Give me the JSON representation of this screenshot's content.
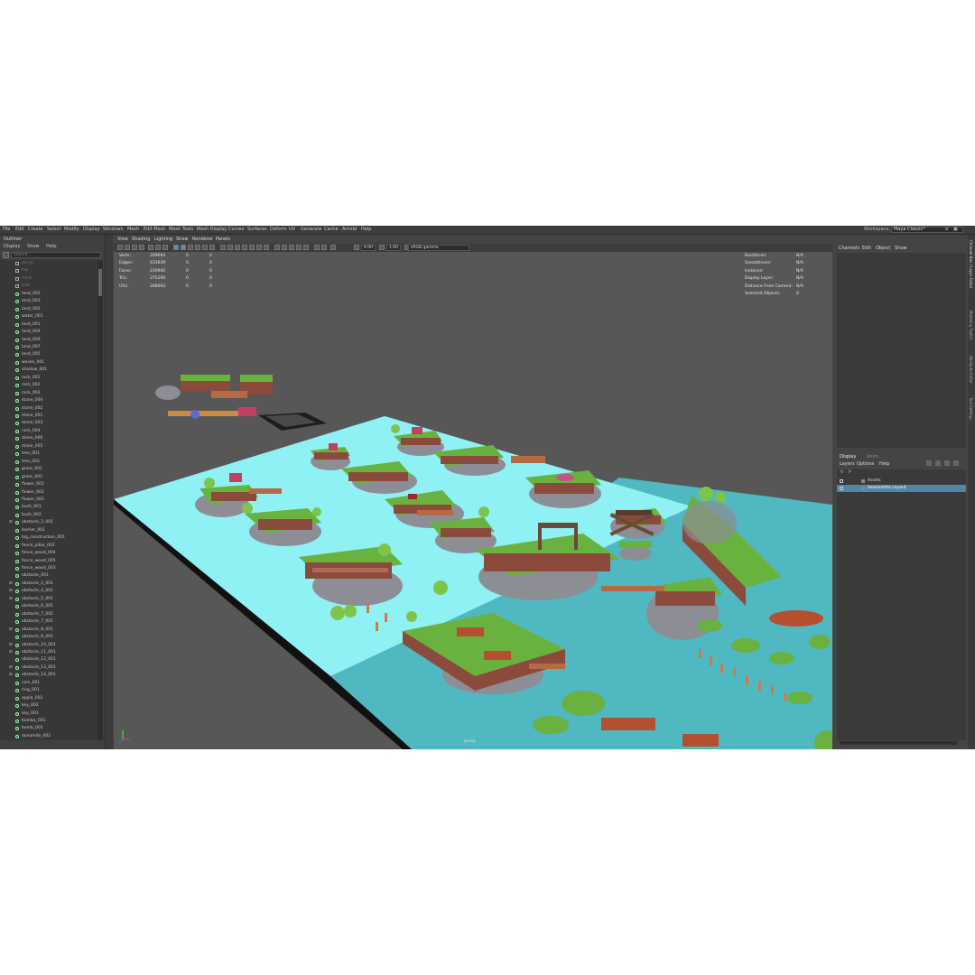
{
  "menubar": {
    "items": [
      "File",
      "Edit",
      "Create",
      "Select",
      "Modify",
      "Display",
      "Windows",
      "Mesh",
      "Edit Mesh",
      "Mesh Tools",
      "Mesh Display",
      "Curves",
      "Surfaces",
      "Deform",
      "UV",
      "Generate",
      "Cache",
      "Arnold",
      "Help"
    ],
    "workspace_label": "Workspace:",
    "workspace_value": "Maya Classic*"
  },
  "outliner": {
    "title": "Outliner",
    "menus": [
      "Display",
      "Show",
      "Help"
    ],
    "search_placeholder": "Search...",
    "items": [
      {
        "label": "persp",
        "dim": true
      },
      {
        "label": "top",
        "dim": true
      },
      {
        "label": "front",
        "dim": true
      },
      {
        "label": "side",
        "dim": true
      },
      {
        "label": "land_002"
      },
      {
        "label": "land_003"
      },
      {
        "label": "land_002"
      },
      {
        "label": "water_001"
      },
      {
        "label": "land_001"
      },
      {
        "label": "land_004"
      },
      {
        "label": "land_006"
      },
      {
        "label": "land_007"
      },
      {
        "label": "land_005"
      },
      {
        "label": "waves_001"
      },
      {
        "label": "shadow_001"
      },
      {
        "label": "rock_001"
      },
      {
        "label": "rock_002"
      },
      {
        "label": "rock_003"
      },
      {
        "label": "stone_004"
      },
      {
        "label": "stone_002"
      },
      {
        "label": "stone_001"
      },
      {
        "label": "stone_003"
      },
      {
        "label": "rock_004"
      },
      {
        "label": "stone_006"
      },
      {
        "label": "stone_005"
      },
      {
        "label": "tree_001"
      },
      {
        "label": "tree_002"
      },
      {
        "label": "grass_001"
      },
      {
        "label": "grass_002"
      },
      {
        "label": "flower_001"
      },
      {
        "label": "flower_002"
      },
      {
        "label": "flower_003"
      },
      {
        "label": "bush_001"
      },
      {
        "label": "bush_002"
      },
      {
        "label": "obstacle_3_001",
        "expand": true
      },
      {
        "label": "barrier_001"
      },
      {
        "label": "log_construction_001"
      },
      {
        "label": "fence_pillar_002"
      },
      {
        "label": "fence_wood_004"
      },
      {
        "label": "fence_wood_005"
      },
      {
        "label": "fence_wood_003"
      },
      {
        "label": "obstacle_001"
      },
      {
        "label": "obstacle_2_001",
        "expand": true
      },
      {
        "label": "obstacle_4_001",
        "expand": true
      },
      {
        "label": "obstacle_5_001",
        "expand": true
      },
      {
        "label": "obstacle_6_001"
      },
      {
        "label": "obstacle_7_002"
      },
      {
        "label": "obstacle_7_001"
      },
      {
        "label": "obstacle_8_001",
        "expand": true
      },
      {
        "label": "obstacle_9_001"
      },
      {
        "label": "obstacle_10_001",
        "expand": true
      },
      {
        "label": "obstacle_11_001",
        "expand": true
      },
      {
        "label": "obstacle_12_001"
      },
      {
        "label": "obstacle_13_001",
        "expand": true
      },
      {
        "label": "obstacle_14_001",
        "expand": true
      },
      {
        "label": "coin_001"
      },
      {
        "label": "ring_001"
      },
      {
        "label": "apple_001"
      },
      {
        "label": "key_002"
      },
      {
        "label": "key_001"
      },
      {
        "label": "bomba_001"
      },
      {
        "label": "bomb_001"
      },
      {
        "label": "dynamite_002"
      }
    ]
  },
  "viewport": {
    "menus": [
      "View",
      "Shading",
      "Lighting",
      "Show",
      "Renderer",
      "Panels"
    ],
    "field_a": "0.00",
    "field_b": "1.00",
    "colorspace": "sRGB gamma",
    "stats": [
      {
        "label": "Verts:",
        "value": "209693",
        "c1": "0",
        "c2": "0"
      },
      {
        "label": "Edges:",
        "value": "433639",
        "c1": "0",
        "c2": "0"
      },
      {
        "label": "Faces:",
        "value": "230942",
        "c1": "0",
        "c2": "0"
      },
      {
        "label": "Tris:",
        "value": "375290",
        "c1": "0",
        "c2": "0"
      },
      {
        "label": "UVs:",
        "value": "268093",
        "c1": "0",
        "c2": "0"
      }
    ],
    "info": [
      {
        "label": "Backfaces:",
        "value": "N/A"
      },
      {
        "label": "Smoothness:",
        "value": "N/A"
      },
      {
        "label": "Instance:",
        "value": "N/A"
      },
      {
        "label": "Display Layer:",
        "value": "N/A"
      },
      {
        "label": "Distance From Camera:",
        "value": "N/A"
      },
      {
        "label": "Selected Objects:",
        "value": "0"
      }
    ],
    "camera_label": "persp"
  },
  "channel_box": {
    "menus": [
      "Channels",
      "Edit",
      "Object",
      "Show"
    ]
  },
  "layer_editor": {
    "tabs": [
      "Display",
      "Anim"
    ],
    "menus": [
      "Layers",
      "Options",
      "Help"
    ],
    "header_v": "V",
    "header_p": "P",
    "layers": [
      {
        "name": "Assets",
        "selected": false
      },
      {
        "name": "Sessiontitle Layout",
        "selected": true
      }
    ]
  },
  "side_tabs": [
    "Channel Box / Layer Editor",
    "Modeling Toolkit",
    "Attribute Editor",
    "Tool Settings"
  ],
  "colors": {
    "ui_bg": "#444444",
    "viewport_bg": "#575757",
    "water": "#8ff1f3",
    "sea": "#4fb8c0",
    "grass": "#6ab23f",
    "dirt": "#8a4b3d",
    "rock": "#8d8d96",
    "selection": "#5285a6"
  }
}
